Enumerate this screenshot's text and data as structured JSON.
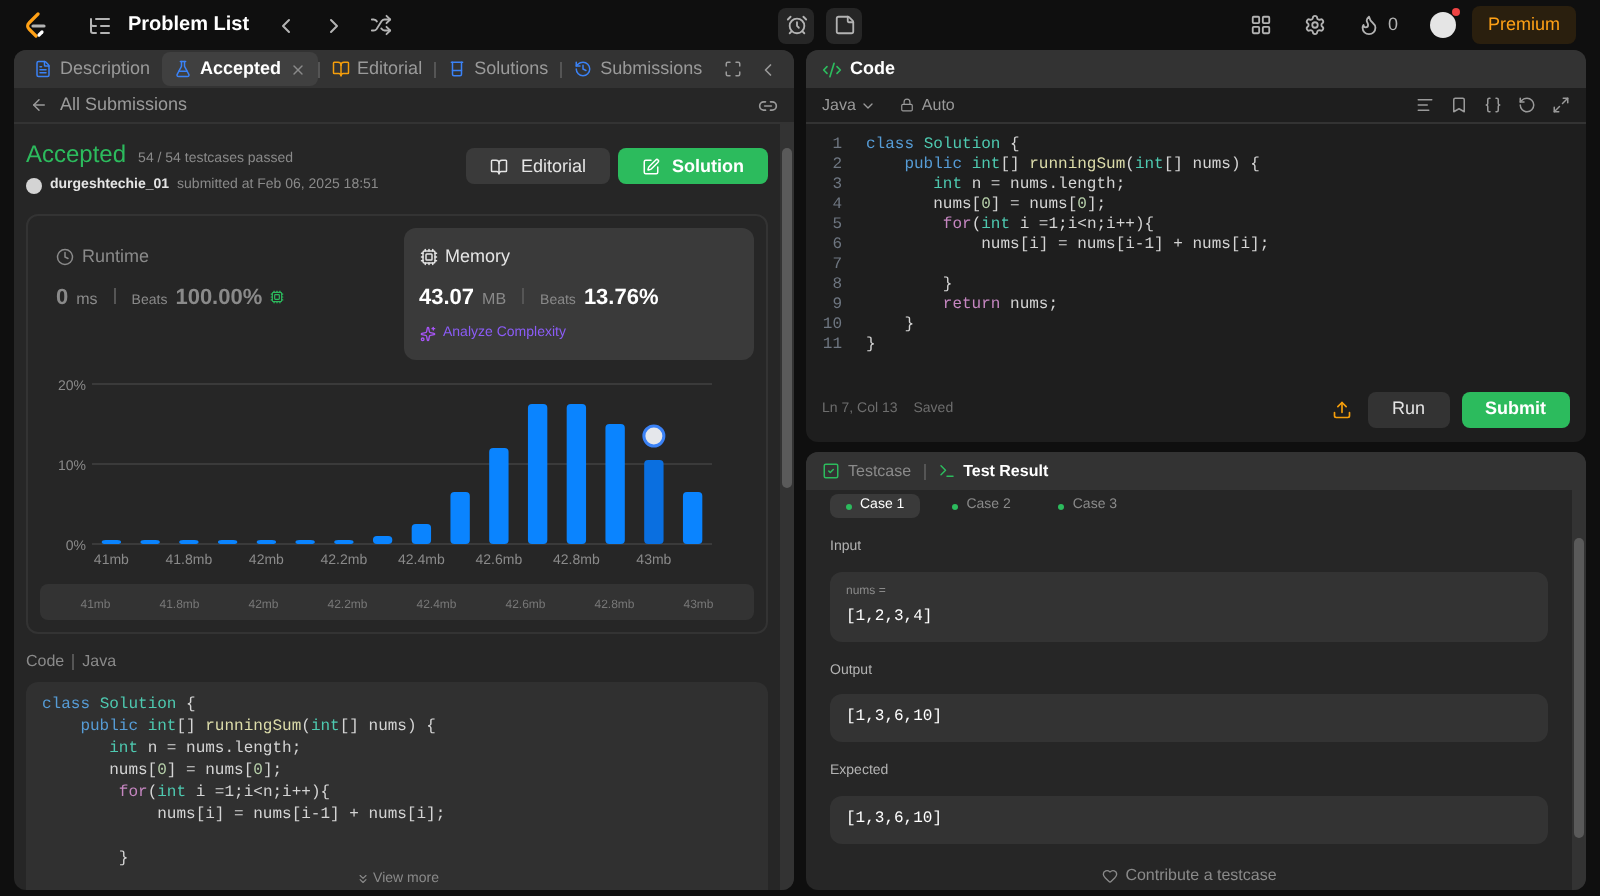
{
  "top_bar": {
    "title": "Problem List",
    "streak": "0",
    "premium": "Premium"
  },
  "left_tabs": [
    {
      "label": "Description",
      "selected": false,
      "closable": false
    },
    {
      "label": "Accepted",
      "selected": true,
      "closable": true
    },
    {
      "label": "Editorial",
      "selected": false,
      "closable": false
    },
    {
      "label": "Solutions",
      "selected": false,
      "closable": false
    },
    {
      "label": "Submissions",
      "selected": false,
      "closable": false
    }
  ],
  "back_link": "All Submissions",
  "submission": {
    "status": "Accepted",
    "passed": "54 / 54 testcases passed",
    "user": "durgeshtechie_01",
    "submitted": "submitted at Feb 06, 2025 18:51",
    "buttons": [
      {
        "label": "Editorial",
        "kind": "secondary"
      },
      {
        "label": "Solution",
        "kind": "primary"
      }
    ]
  },
  "runtime": {
    "label": "Runtime",
    "value": "0",
    "unit": "ms",
    "beats_label": "Beats",
    "beats": "100.00%",
    "selected": false
  },
  "memory": {
    "label": "Memory",
    "value": "43.07",
    "unit": "MB",
    "beats_label": "Beats",
    "beats": "13.76%",
    "selected": true,
    "analyze": "Analyze Complexity"
  },
  "chart_data": {
    "type": "bar",
    "x": [
      41.6,
      41.7,
      41.8,
      41.9,
      42,
      42.1,
      42.2,
      42.3,
      42.4,
      42.5,
      42.6,
      42.7,
      42.8,
      42.9,
      43,
      43.1
    ],
    "values": [
      0.5,
      0.5,
      0.5,
      0.5,
      0.5,
      0.5,
      0.5,
      1,
      2.5,
      6.5,
      12,
      17.5,
      17.5,
      15,
      10.5,
      6.5
    ],
    "xlim": [
      41.55,
      43.15
    ],
    "ylim": [
      0,
      20
    ],
    "yticks": [
      {
        "value": 0,
        "label": "0%"
      },
      {
        "value": 10,
        "label": "10%"
      },
      {
        "value": 20,
        "label": "20%"
      }
    ],
    "xticks": [
      {
        "value": 41.8,
        "label": "41.8mb"
      },
      {
        "value": 42,
        "label": "42mb"
      },
      {
        "value": 42.2,
        "label": "42.2mb"
      },
      {
        "value": 42.4,
        "label": "42.4mb"
      },
      {
        "value": 42.6,
        "label": "42.6mb"
      },
      {
        "value": 42.8,
        "label": "42.8mb"
      },
      {
        "value": 43,
        "label": "43mb"
      }
    ]
  },
  "chart_first_bar_label": "41mb",
  "range_labels": [
    "41mb",
    "41.8mb",
    "42mb",
    "42.2mb",
    "42.4mb",
    "42.6mb",
    "42.8mb",
    "43mb"
  ],
  "code_header": {
    "label": "Code",
    "language": "Java"
  },
  "submitted_code": [
    {
      "tokens": [
        {
          "t": "class ",
          "kind": "kw"
        },
        {
          "t": "Solution",
          "kind": "type"
        },
        {
          "t": " {",
          "kind": "plain"
        }
      ]
    },
    {
      "tokens": [
        {
          "t": "    public ",
          "kind": "kw"
        },
        {
          "t": "int",
          "kind": "type"
        },
        {
          "t": "[] ",
          "kind": "plain"
        },
        {
          "t": "runningSum",
          "kind": "fn"
        },
        {
          "t": "(",
          "kind": "plain"
        },
        {
          "t": "int",
          "kind": "type"
        },
        {
          "t": "[] nums) {",
          "kind": "plain"
        }
      ]
    },
    {
      "tokens": [
        {
          "t": "       int",
          "kind": "type"
        },
        {
          "t": " n = nums.length;",
          "kind": "plain"
        }
      ]
    },
    {
      "tokens": [
        {
          "t": "       nums[",
          "kind": "plain"
        },
        {
          "t": "0",
          "kind": "num"
        },
        {
          "t": "] = nums[",
          "kind": "plain"
        },
        {
          "t": "0",
          "kind": "num"
        },
        {
          "t": "];",
          "kind": "plain"
        }
      ]
    },
    {
      "tokens": [
        {
          "t": "        for",
          "kind": "ctl"
        },
        {
          "t": "(",
          "kind": "plain"
        },
        {
          "t": "int",
          "kind": "type"
        },
        {
          "t": " i =1;i<n;i++){",
          "kind": "plain"
        }
      ]
    },
    {
      "tokens": [
        {
          "t": "            nums[i] = nums[i-1] + nums[i];",
          "kind": "plain"
        }
      ]
    },
    {
      "blank": true
    },
    {
      "tokens": [
        {
          "t": "        }",
          "kind": "plain"
        }
      ]
    }
  ],
  "view_more": "View more",
  "editor": {
    "title": "Code",
    "language": "Java",
    "mode": "Auto",
    "status": "Ln 7, Col 13",
    "saved": "Saved",
    "run": "Run",
    "submit": "Submit"
  },
  "editor_code": [
    {
      "n": "1",
      "tokens": [
        {
          "t": "class ",
          "kind": "kw"
        },
        {
          "t": "Solution",
          "kind": "type"
        },
        {
          "t": " {",
          "kind": "plain"
        }
      ]
    },
    {
      "n": "2",
      "tokens": [
        {
          "t": "    public ",
          "kind": "kw"
        },
        {
          "t": "int",
          "kind": "type"
        },
        {
          "t": "[] ",
          "kind": "plain"
        },
        {
          "t": "runningSum",
          "kind": "fn"
        },
        {
          "t": "(",
          "kind": "plain"
        },
        {
          "t": "int",
          "kind": "type"
        },
        {
          "t": "[] nums) {",
          "kind": "plain"
        }
      ]
    },
    {
      "n": "3",
      "tokens": [
        {
          "t": "       int",
          "kind": "type"
        },
        {
          "t": " n = nums.length;",
          "kind": "plain"
        }
      ]
    },
    {
      "n": "4",
      "tokens": [
        {
          "t": "       nums[",
          "kind": "plain"
        },
        {
          "t": "0",
          "kind": "num"
        },
        {
          "t": "] = nums[",
          "kind": "plain"
        },
        {
          "t": "0",
          "kind": "num"
        },
        {
          "t": "];",
          "kind": "plain"
        }
      ]
    },
    {
      "n": "5",
      "tokens": [
        {
          "t": "        for",
          "kind": "ctl"
        },
        {
          "t": "(",
          "kind": "plain"
        },
        {
          "t": "int",
          "kind": "type"
        },
        {
          "t": " i =1;i<n;i++){",
          "kind": "plain"
        }
      ]
    },
    {
      "n": "6",
      "tokens": [
        {
          "t": "            nums[i] = nums[i-1] + nums[i];",
          "kind": "plain"
        }
      ]
    },
    {
      "n": "7"
    },
    {
      "n": "8",
      "tokens": [
        {
          "t": "        }",
          "kind": "plain"
        }
      ]
    },
    {
      "n": "9",
      "tokens": [
        {
          "t": "        return",
          "kind": "ctl"
        },
        {
          "t": " nums;",
          "kind": "plain"
        }
      ]
    },
    {
      "n": "10",
      "tokens": [
        {
          "t": "    }",
          "kind": "plain"
        }
      ]
    },
    {
      "n": "11",
      "tokens": [
        {
          "t": "}",
          "kind": "plain"
        }
      ]
    }
  ],
  "result_tabs": [
    {
      "label": "Testcase",
      "selected": false
    },
    {
      "label": "Test Result",
      "selected": true
    }
  ],
  "cases": [
    {
      "label": "Case 1",
      "selected": true
    },
    {
      "label": "Case 2",
      "selected": false
    },
    {
      "label": "Case 3",
      "selected": false
    }
  ],
  "input": {
    "label": "Input",
    "param": "nums =",
    "value": "[1,2,3,4]"
  },
  "output": {
    "label": "Output",
    "value": "[1,3,6,10]"
  },
  "expected": {
    "label": "Expected",
    "value": "[1,3,6,10]"
  },
  "contribute": "Contribute a testcase"
}
